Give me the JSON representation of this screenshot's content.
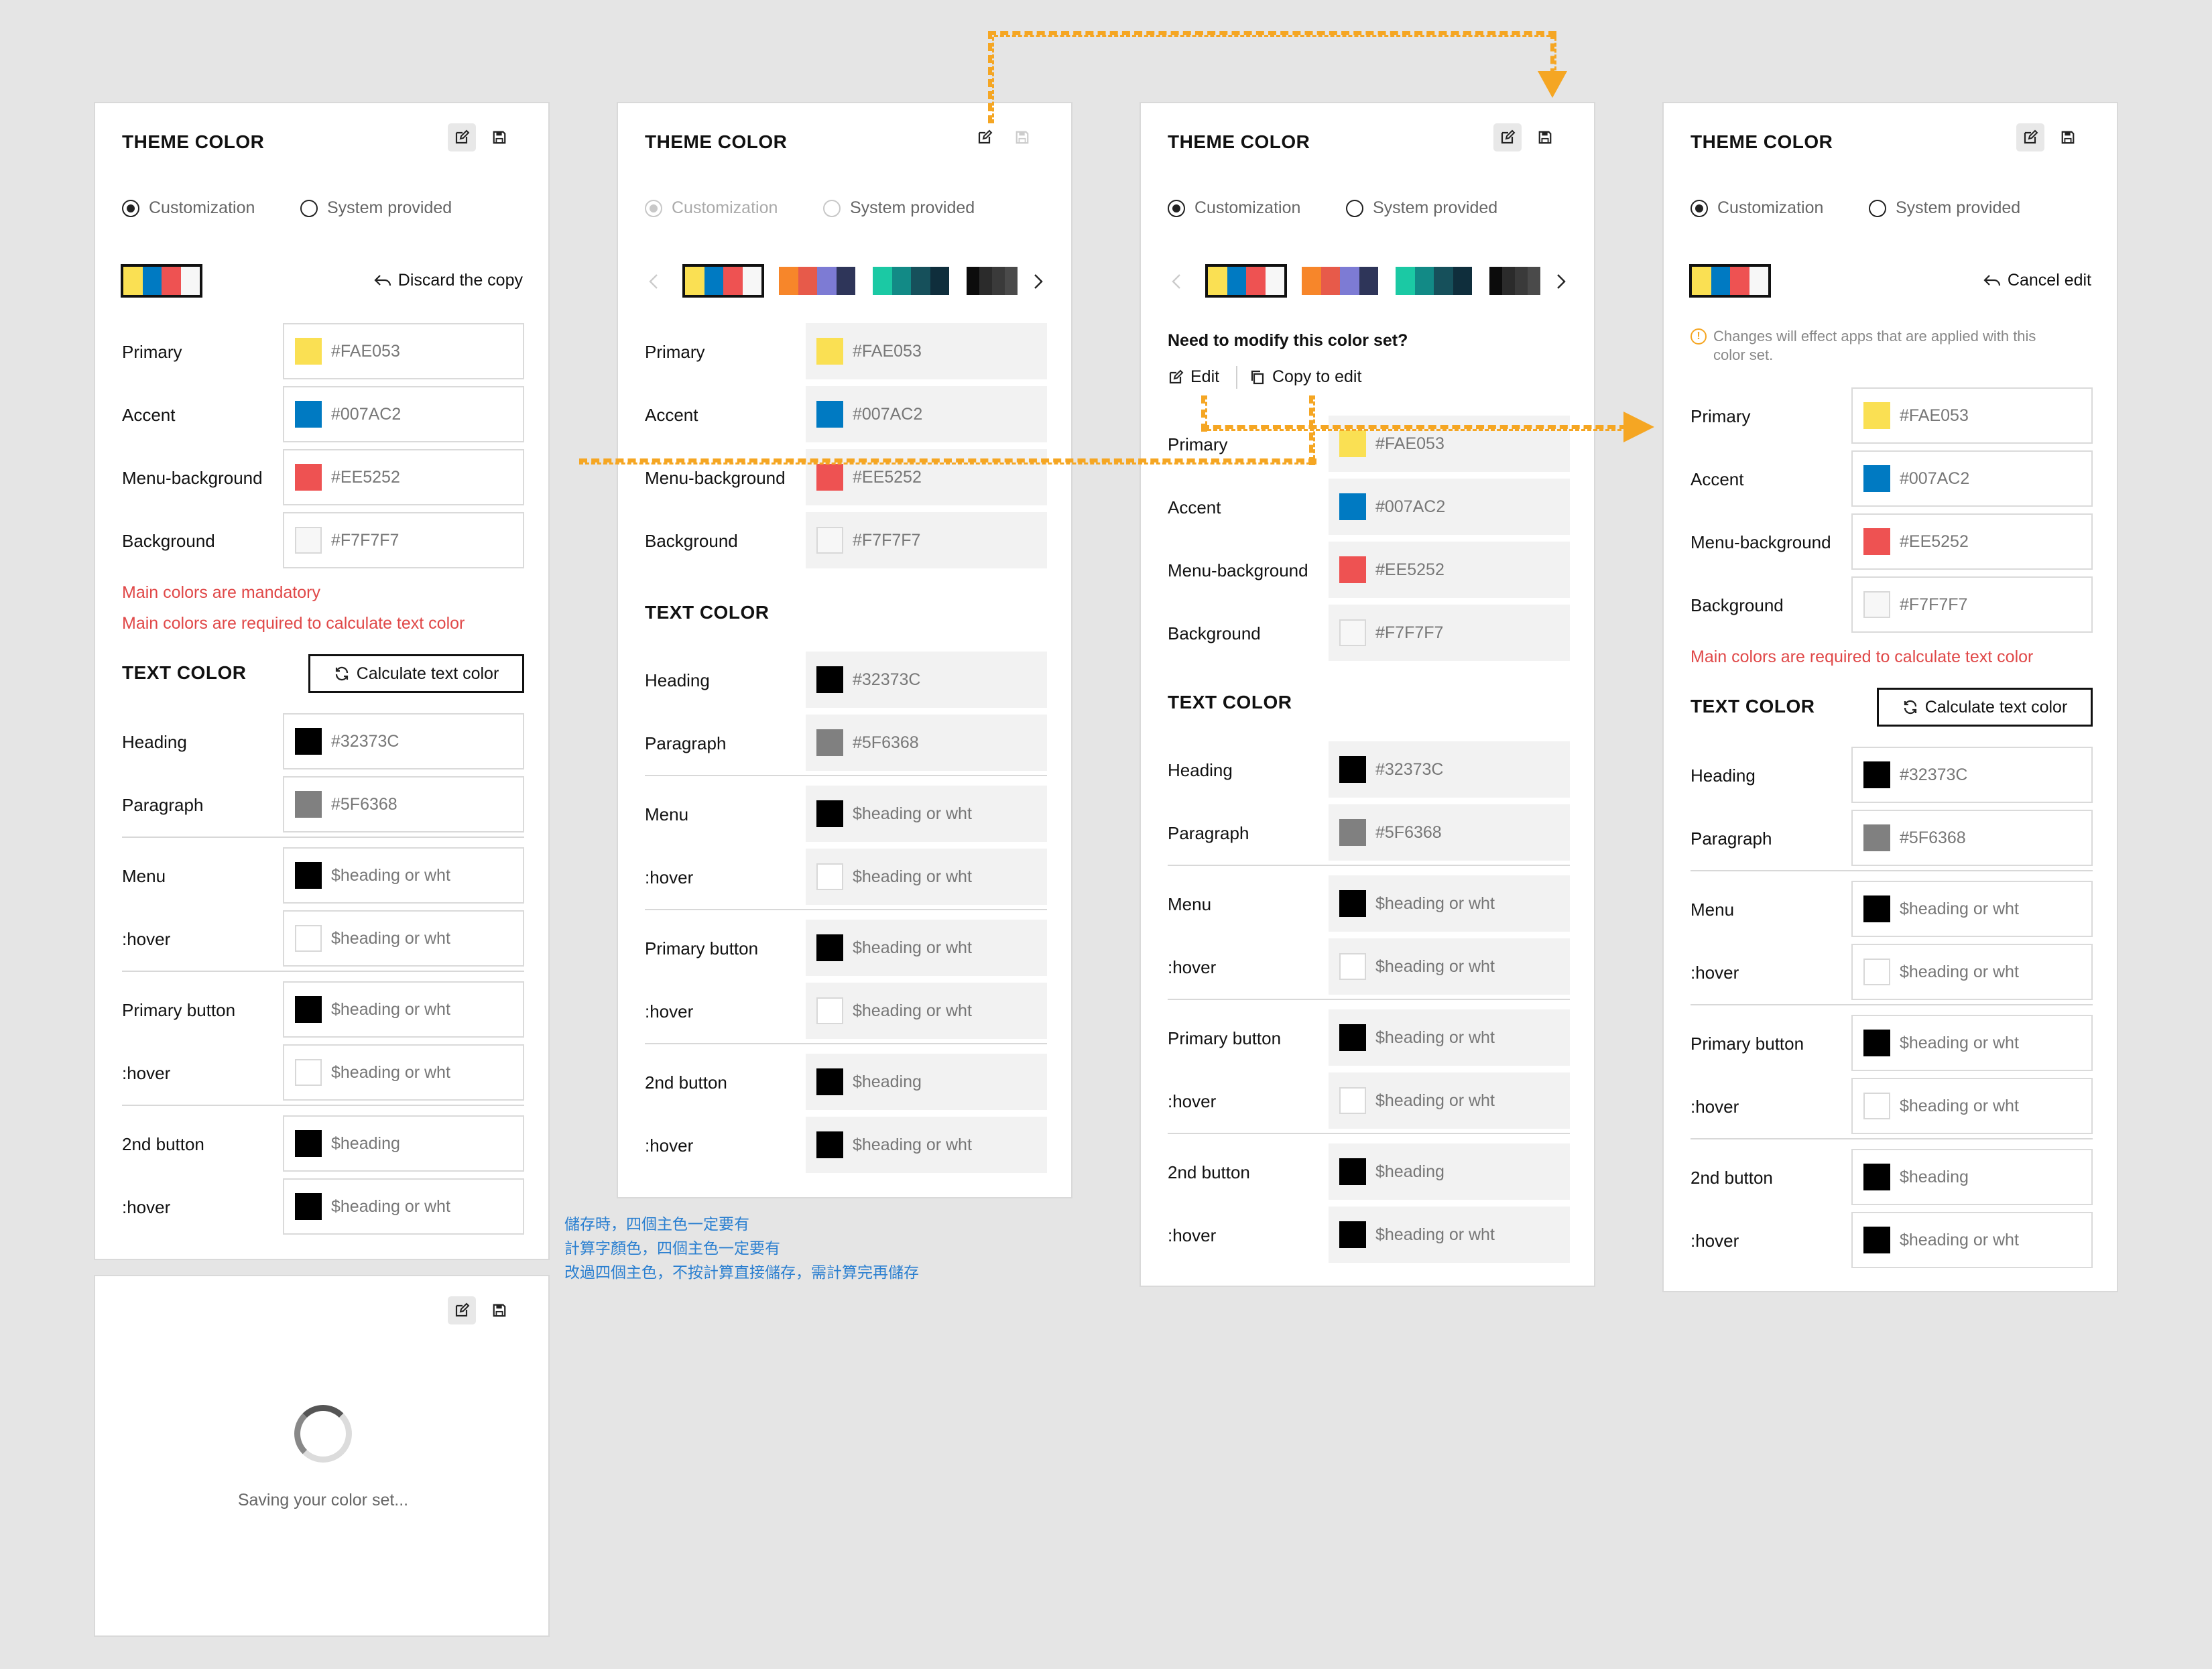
{
  "colors": {
    "primary": "#FAE053",
    "accent": "#007AC2",
    "menu_bg": "#EE5252",
    "background": "#F7F7F7",
    "heading": "#32373C",
    "paragraph": "#5F6368",
    "error": "#E04848",
    "annotation": "#F5A623",
    "note_text": "#2A7FD0"
  },
  "icons": {
    "edit": "edit-icon",
    "save": "save-icon",
    "undo": "undo-icon",
    "refresh": "refresh-icon",
    "copy": "copy-icon",
    "info": "info-icon"
  },
  "common": {
    "title": "THEME COLOR",
    "text_color_title": "TEXT COLOR",
    "radio_custom": "Customization",
    "radio_system": "System provided",
    "calc_button": "Calculate text color",
    "main_fields": [
      {
        "label": "Primary",
        "value": "#FAE053"
      },
      {
        "label": "Accent",
        "value": "#007AC2"
      },
      {
        "label": "Menu-background",
        "value": "#EE5252"
      },
      {
        "label": "Background",
        "value": "#F7F7F7"
      }
    ],
    "text_fields": [
      {
        "label": "Heading",
        "value": "#32373C"
      },
      {
        "label": "Paragraph",
        "value": "#5F6368"
      },
      {
        "label": "Menu",
        "value": "$heading or wht"
      },
      {
        "label": ":hover",
        "value": "$heading or wht"
      },
      {
        "label": "Primary button",
        "value": "$heading or wht"
      },
      {
        "label": ":hover",
        "value": "$heading or wht"
      },
      {
        "label": "2nd button",
        "value": "$heading"
      },
      {
        "label": ":hover",
        "value": "$heading or wht"
      }
    ]
  },
  "panel1": {
    "discard_label": "Discard the copy",
    "err_mandatory": "Main colors are mandatory",
    "err_required": "Main colors are required to calculate text color"
  },
  "panel3": {
    "question": "Need to modify this color set?",
    "edit_label": "Edit",
    "copy_label": "Copy to edit"
  },
  "panel4": {
    "cancel_label": "Cancel edit",
    "info_text_1": "Changes will effect apps that are applied with this",
    "info_text_2": "color set.",
    "err_required": "Main colors are required to calculate text color"
  },
  "loading": {
    "text": "Saving your color set..."
  },
  "notes": [
    "儲存時，四個主色一定要有",
    "計算字顏色，四個主色一定要有",
    "改過四個主色，不按計算直接儲存，需計算完再儲存"
  ],
  "palettes": [
    [
      "#FAE053",
      "#007AC2",
      "#EE5252",
      "#F7F7F7"
    ],
    [
      "#F7862A",
      "#E75A4A",
      "#7D7BD4",
      "#2E3559"
    ],
    [
      "#1BC9A4",
      "#128A86",
      "#16505B",
      "#0F2E3C"
    ],
    [
      "#0C0C0C",
      "#2B2B2B",
      "#3A3A3A",
      "#4A4A4A"
    ]
  ]
}
